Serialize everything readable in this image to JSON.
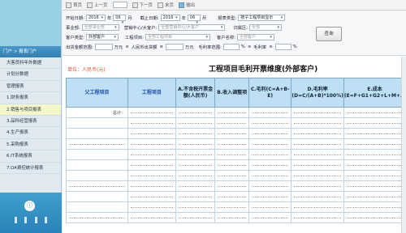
{
  "sidebar": {
    "header": "门户 > 报表门户",
    "items": [
      {
        "label": "大客员科年外数据"
      },
      {
        "label": "计划分数据"
      },
      {
        "label": "管理报表"
      },
      {
        "label": "1.财务报表"
      },
      {
        "label": "2.销售与项目报表"
      },
      {
        "label": "3.品科经营报表"
      },
      {
        "label": "4.生产报表"
      },
      {
        "label": "5.采购报表"
      },
      {
        "label": "6.IT系统报表"
      },
      {
        "label": "7.OA费控统计报表"
      }
    ],
    "active_index": 4,
    "bottom_icon": "info-circle-icon"
  },
  "toolbar": {
    "items": [
      "首页",
      "上一页",
      "下一页",
      "末页",
      "输出"
    ]
  },
  "filters": {
    "start_date_label": "开始日期:",
    "start_year": "2016",
    "start_month": "06",
    "month_unit": "月",
    "end_date_label": "截止日期:",
    "end_year": "2016",
    "end_month": "06",
    "report_type_label": "报表类型:",
    "report_type_value": "按子工程项目显示",
    "business_label": "事业部:",
    "business_placeholder": "全部事业部",
    "sales_label": "营销中心/大客户:",
    "sales_placeholder": "全部营销中心/大客户",
    "region_label": "归属区:",
    "region_placeholder": "全部",
    "customer_type_label": "客户类型:",
    "customer_type_value": "外部客户",
    "project_label": "工程项目:",
    "project_placeholder": "全部工程项目",
    "customer_label": "客户名称:",
    "customer_placeholder": "全部客户",
    "amount_label": "出货金额范围:",
    "amount_unit": "万元",
    "amount_le": "≤",
    "amount_desc": "人民币出货额",
    "margin_label": "毛利率范围:",
    "margin_unit": "%",
    "margin_desc": "毛利率",
    "query_label": "查询"
  },
  "report": {
    "unit": "单位：人民币(元)",
    "title": "工程项目毛利开票维度(外部客户)",
    "headers": [
      "父工程项目",
      "工程项目",
      "A.不含税开票金额(人民币)",
      "B.收入调整项",
      "C.毛利(C=A+B-E)",
      "D.毛利率(D=C/(A+B)*100%)",
      "E.成本(E=F+G1+G2+L+M+…"
    ],
    "total_label": "总计："
  }
}
